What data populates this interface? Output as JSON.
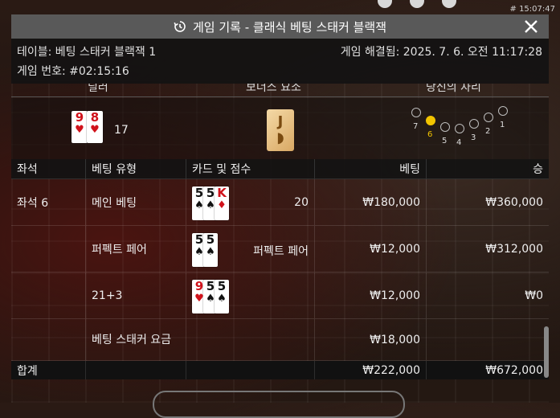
{
  "clock": "# 15:07:47",
  "modal": {
    "title": "게임 기록 - 클래식 베팅 스태커 블랙잭",
    "table": "테이블: 베팅 스태커 블랙잭 1",
    "resolved": "게임 해결됨: 2025. 7. 6. 오전 11:17:28",
    "game_number": "게임 번호: #02:15:16"
  },
  "sections": {
    "dealer": "딜러",
    "bonus": "보너스 요소",
    "your_seat": "당신의 자리"
  },
  "dealer": {
    "cards": [
      {
        "rank": "9",
        "suit": "♥",
        "color": "red"
      },
      {
        "rank": "8",
        "suit": "♥",
        "color": "red"
      }
    ],
    "total": "17"
  },
  "bonus_card": {
    "rank": "J",
    "suit": "◗"
  },
  "seat_map": {
    "labels": [
      "7",
      "6",
      "5",
      "4",
      "3",
      "2",
      "1"
    ],
    "active": "6"
  },
  "table": {
    "headers": [
      "좌석",
      "베팅 유형",
      "카드 및 점수",
      "베팅",
      "승"
    ],
    "rows": [
      {
        "seat": "좌석 6",
        "type": "메인 베팅",
        "cards": [
          {
            "rank": "5",
            "suit": "♠",
            "color": "blk"
          },
          {
            "rank": "5",
            "suit": "♠",
            "color": "blk"
          },
          {
            "rank": "K",
            "suit": "♦",
            "color": "red"
          }
        ],
        "score": "20",
        "bet": "₩180,000",
        "win": "₩360,000"
      },
      {
        "seat": "",
        "type": "퍼펙트 페어",
        "cards": [
          {
            "rank": "5",
            "suit": "♠",
            "color": "blk"
          },
          {
            "rank": "5",
            "suit": "♠",
            "color": "blk"
          }
        ],
        "score": "퍼펙트 페어",
        "bet": "₩12,000",
        "win": "₩312,000"
      },
      {
        "seat": "",
        "type": "21+3",
        "cards": [
          {
            "rank": "9",
            "suit": "♥",
            "color": "red"
          },
          {
            "rank": "5",
            "suit": "♠",
            "color": "blk"
          },
          {
            "rank": "5",
            "suit": "♠",
            "color": "blk"
          }
        ],
        "score": "",
        "bet": "₩12,000",
        "win": "₩0"
      },
      {
        "seat": "",
        "type": "베팅 스태커 요금",
        "cards": [],
        "score": "",
        "bet": "₩18,000",
        "win": ""
      }
    ],
    "total": {
      "label": "합계",
      "bet": "₩222,000",
      "win": "₩672,000"
    }
  }
}
